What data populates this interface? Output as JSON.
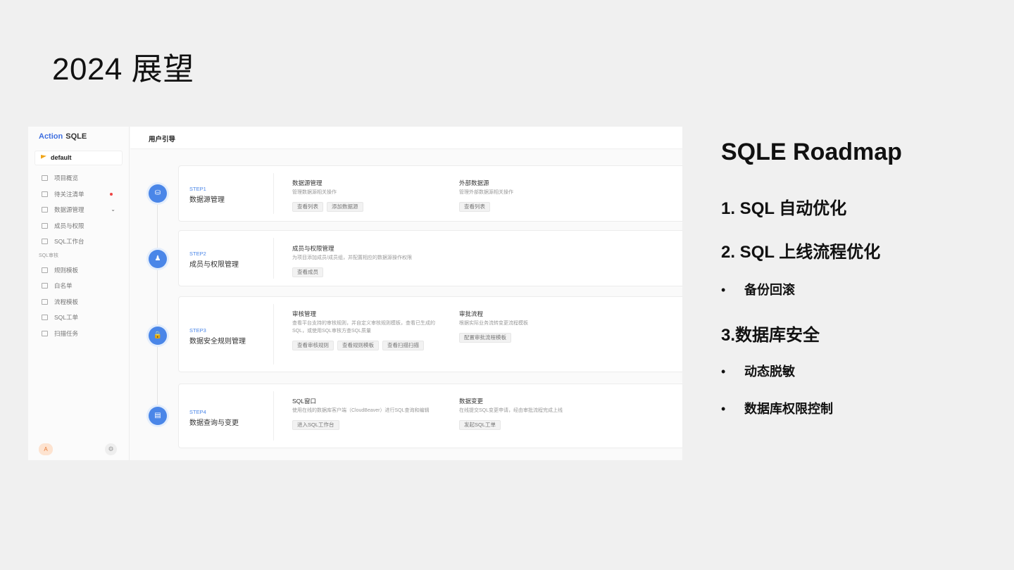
{
  "slide": {
    "title": "2024 展望"
  },
  "app": {
    "brand_part1": "Action",
    "brand_part2": "SQLE",
    "project": "default",
    "menu": [
      {
        "label": "项目概览"
      },
      {
        "label": "待关注清单",
        "badge": true
      },
      {
        "label": "数据源管理",
        "chevron": "⌄"
      },
      {
        "label": "成员与权限"
      },
      {
        "label": "SQL工作台"
      }
    ],
    "group_label": "SQL审核",
    "menu2": [
      {
        "label": "规则模板"
      },
      {
        "label": "白名单"
      },
      {
        "label": "流程模板"
      },
      {
        "label": "SQL工单"
      },
      {
        "label": "扫描任务"
      }
    ],
    "avatar": "A",
    "gear_icon": "⚙",
    "page_title": "用户引导",
    "steps": [
      {
        "label": "STEP1",
        "name": "数据源管理",
        "icon": "⛁",
        "blocks": [
          {
            "title": "数据源管理",
            "desc": "管理数据源相关操作",
            "buttons": [
              "查看列表",
              "添加数据源"
            ]
          },
          {
            "title": "外部数据源",
            "desc": "管理外部数据源相关操作",
            "buttons": [
              "查看列表"
            ]
          }
        ]
      },
      {
        "label": "STEP2",
        "name": "成员与权限管理",
        "icon": "♟",
        "blocks": [
          {
            "title": "成员与权限管理",
            "desc": "为项目添加成员/成员组，并配置相应的数据源操作权限",
            "buttons": [
              "查看成员"
            ]
          }
        ]
      },
      {
        "label": "STEP3",
        "name": "数据安全规则管理",
        "icon": "🔒",
        "blocks": [
          {
            "title": "审核管理",
            "desc": "查看平台支持的审核规则，并自定义审核规则模板，查看已生成的SQL，或使用SQL审核方查SQL质量",
            "buttons": [
              "查看审核规则",
              "查看规则模板",
              "查看扫描扫描"
            ]
          },
          {
            "title": "审批流程",
            "desc": "根据实际业务流转变更流程模板",
            "buttons": [
              "配置审批流程模板"
            ]
          }
        ]
      },
      {
        "label": "STEP4",
        "name": "数据查询与变更",
        "icon": "▤",
        "blocks": [
          {
            "title": "SQL窗口",
            "desc": "使用在线的数据库客户端（CloudBeaver）进行SQL查询和编辑",
            "buttons": [
              "进入SQL工作台"
            ]
          },
          {
            "title": "数据变更",
            "desc": "在线提交SQL变更申请，经由审批流程完成上线",
            "buttons": [
              "发起SQL工单"
            ]
          }
        ]
      }
    ]
  },
  "roadmap": {
    "title": "SQLE Roadmap",
    "item1": "1. SQL 自动优化",
    "item2": "2. SQL 上线流程优化",
    "item2_bullets": [
      "备份回滚"
    ],
    "item3": "3.数据库安全",
    "item3_bullets": [
      "动态脱敏",
      "数据库权限控制"
    ],
    "bullet_char": "•"
  }
}
